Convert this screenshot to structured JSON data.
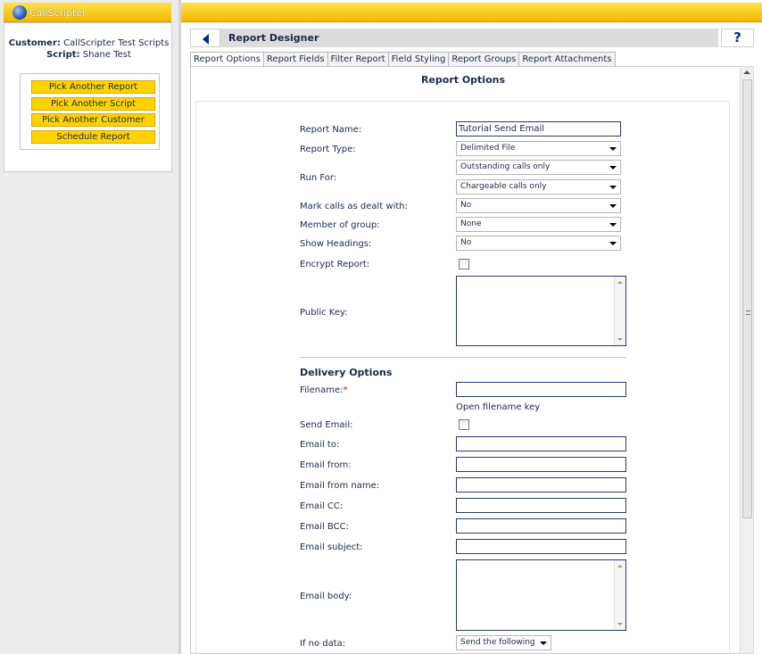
{
  "app": {
    "logo_text": "CallScripter"
  },
  "sidebar": {
    "customer_label": "Customer:",
    "customer_value": "CallScripter Test Scripts",
    "script_label": "Script:",
    "script_value": "Shane Test",
    "buttons": [
      "Pick Another Report",
      "Pick Another Script",
      "Pick Another Customer",
      "Schedule Report"
    ]
  },
  "header": {
    "title": "Report Designer",
    "help": "?"
  },
  "tabs": [
    "Report Options",
    "Report Fields",
    "Filter Report",
    "Field Styling",
    "Report Groups",
    "Report Attachments"
  ],
  "section_title": "Report Options",
  "form": {
    "report_name_label": "Report Name:",
    "report_name_value": "Tutorial Send Email",
    "report_type_label": "Report Type:",
    "report_type_value": "Delimited File",
    "run_for_label": "Run For:",
    "run_for_value1": "Outstanding calls only",
    "run_for_value2": "Chargeable calls only",
    "mark_calls_label": "Mark calls as dealt with:",
    "mark_calls_value": "No",
    "member_group_label": "Member of group:",
    "member_group_value": "None",
    "show_headings_label": "Show Headings:",
    "show_headings_value": "No",
    "encrypt_label": "Encrypt Report:",
    "public_key_label": "Public Key:",
    "delivery_heading": "Delivery Options",
    "filename_label": "Filename:",
    "filename_required": "*",
    "open_filename_key": "Open filename key",
    "send_email_label": "Send Email:",
    "email_to_label": "Email to:",
    "email_from_label": "Email from:",
    "email_from_name_label": "Email from name:",
    "email_cc_label": "Email CC:",
    "email_bcc_label": "Email BCC:",
    "email_subject_label": "Email subject:",
    "email_body_label": "Email body:",
    "if_no_data_label": "If no data:",
    "if_no_data_value": "Send the following"
  },
  "colors": {
    "accent": "#f3b900",
    "button": "#ffd200",
    "text": "#1a2a4a"
  }
}
